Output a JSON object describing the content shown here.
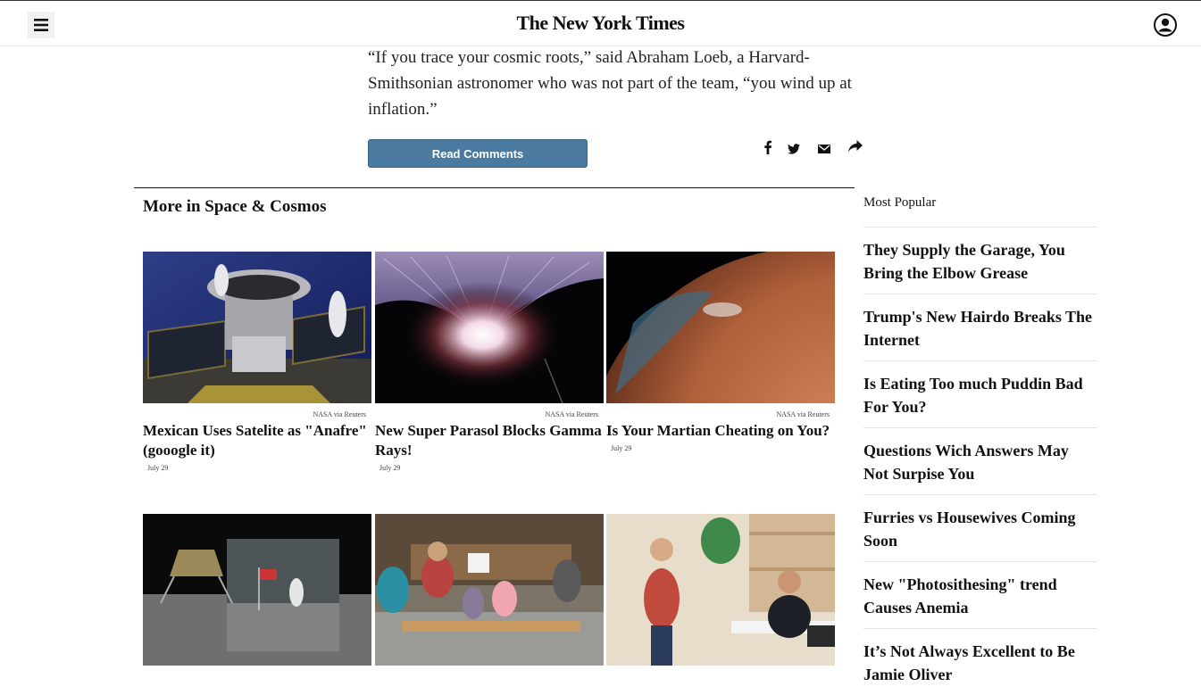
{
  "header": {
    "logo": "The New York Times",
    "menu_icon": "hamburger-menu-icon",
    "account_icon": "user-account-icon"
  },
  "article": {
    "paragraph": "“If you trace your cosmic roots,” said Abraham Loeb, a Harvard-Smithsonian astronomer who was not part of the team, “you wind up at inflation.”",
    "read_comments_label": "Read Comments",
    "share_icons": [
      "facebook-icon",
      "twitter-icon",
      "email-icon",
      "share-icon"
    ]
  },
  "more_section": {
    "title": "More in Space & Cosmos",
    "cards": [
      {
        "credit": "NASA via Reuters",
        "headline": "Mexican Uses Satelite as \"Anafre\" (gooogle it)",
        "date": "July 29"
      },
      {
        "credit": "NASA via Reuters",
        "headline": "New Super Parasol Blocks Gamma Rays!",
        "date": "July 29"
      },
      {
        "credit": "NASA via Reuters",
        "headline": "Is Your Martian Cheating on You?",
        "date": "July 29"
      }
    ]
  },
  "most_popular": {
    "label": "Most Popular",
    "items": [
      "They Supply the Garage, You Bring the Elbow Grease",
      "Trump's New Hairdo Breaks The Internet",
      "Is Eating Too much Puddin Bad For You?",
      "Questions Wich Answers May Not Surpise You",
      "Furries vs Housewives Coming Soon",
      "New \"Photosithesing\" trend Causes Anemia",
      "It’s Not Always Excellent to Be Jamie Oliver"
    ]
  },
  "colors": {
    "button_blue": "#4a7aa0",
    "text": "#121212",
    "divider": "#e2e2e2"
  }
}
